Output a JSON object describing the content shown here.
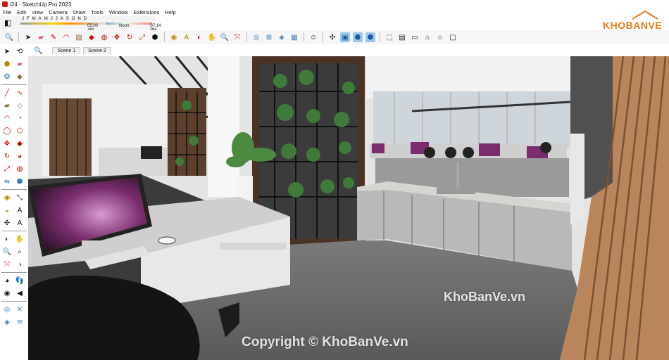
{
  "window": {
    "title": "i24 - SketchUp Pro 2023"
  },
  "menu": [
    "File",
    "Edit",
    "View",
    "Camera",
    "Draw",
    "Tools",
    "Window",
    "Extensions",
    "Help"
  ],
  "shadow": {
    "months": [
      "J",
      "F",
      "M",
      "A",
      "M",
      "J",
      "J",
      "A",
      "S",
      "O",
      "N",
      "D"
    ],
    "time_start": "05:00 AM",
    "time_noon": "Noon",
    "time_end": "07:14 PM"
  },
  "scenes": [
    "Scene 1",
    "Scene 2"
  ],
  "logo": {
    "text": "KHOBANVE",
    "color": "#e87b1b"
  },
  "watermarks": {
    "site": "KhoBanVe.vn",
    "copyright": "Copyright © KhoBanVe.vn"
  },
  "colors": {
    "selected_tool": "#9cc6ee",
    "monitor_screen": "#7a2d6e"
  }
}
